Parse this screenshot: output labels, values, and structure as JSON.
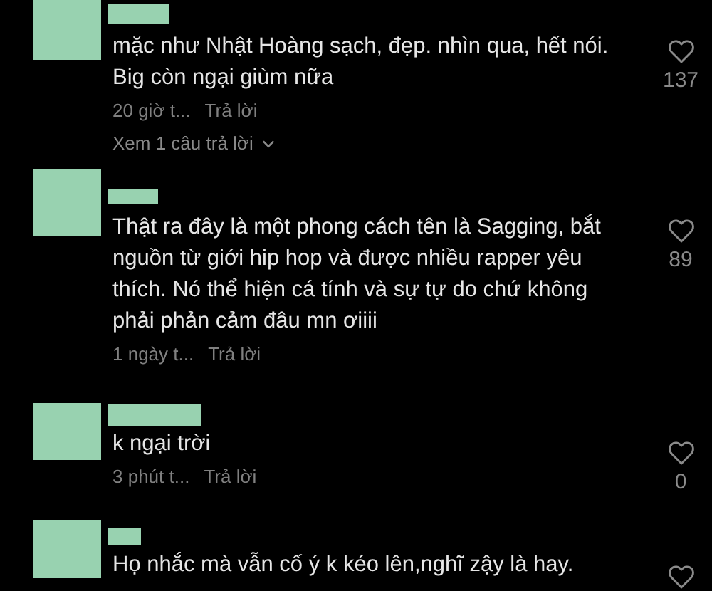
{
  "comments": [
    {
      "text": "mặc như Nhật Hoàng sạch, đẹp. nhìn qua, hết nói. Big còn ngại giùm nữa",
      "time": "20 giờ t...",
      "reply": "Trả lời",
      "likes": "137",
      "view_replies": "Xem 1 câu trả lời"
    },
    {
      "text": "Thật ra đây là một phong cách tên là Sagging, bắt nguồn từ giới hip hop và được nhiều rapper yêu thích. Nó thể hiện cá tính và sự tự do chứ không phải phản cảm đâu mn ơiiii",
      "time": "1 ngày t...",
      "reply": "Trả lời",
      "likes": "89"
    },
    {
      "text": "k ngại trời",
      "time": "3 phút t...",
      "reply": "Trả lời",
      "likes": "0"
    },
    {
      "text": "Họ nhắc mà vẫn cố ý k kéo lên,nghĩ zậy là hay."
    }
  ]
}
